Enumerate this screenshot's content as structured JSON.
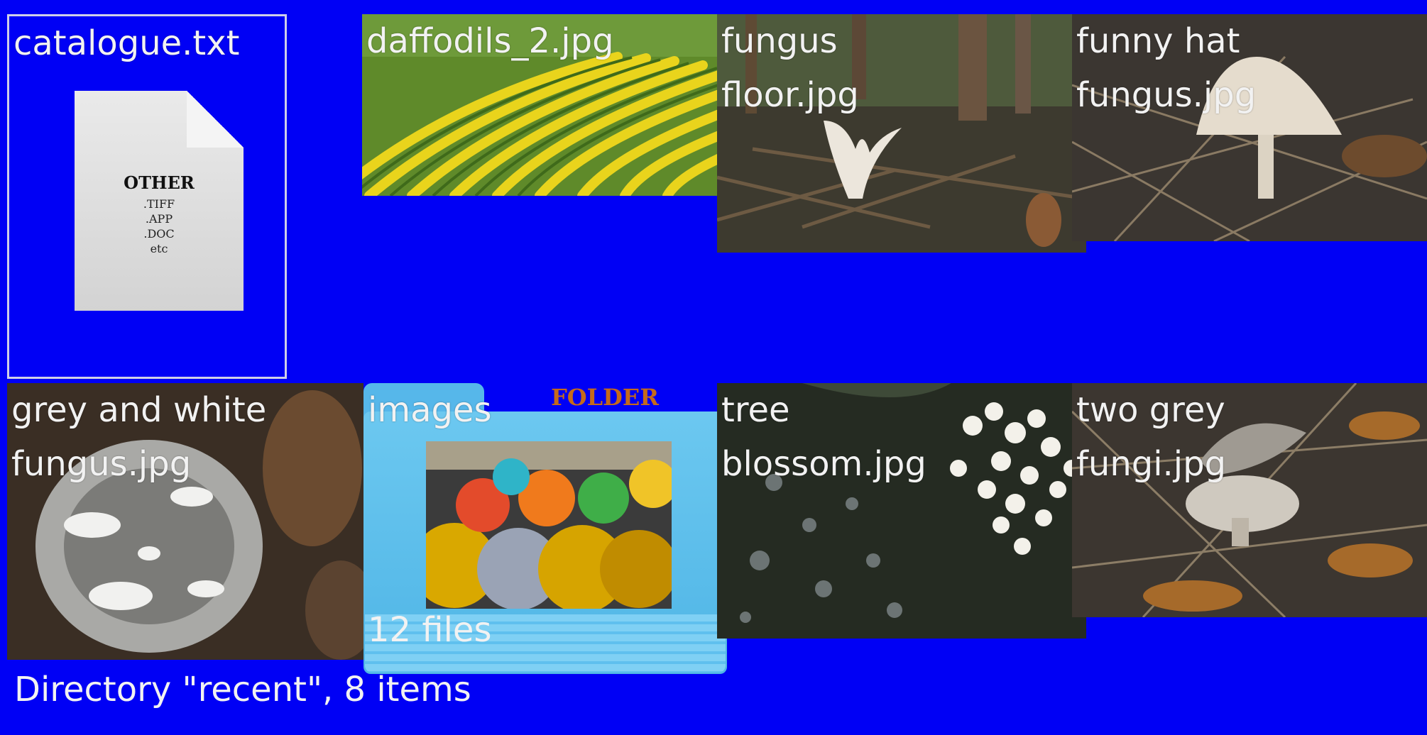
{
  "directory": {
    "status_text": "Directory \"recent\", 8 items"
  },
  "items": [
    {
      "name": "catalogue.txt",
      "type": "document",
      "icon_title": "OTHER",
      "icon_lines": [
        ".TIFF",
        ".APP",
        ".DOC",
        "etc"
      ]
    },
    {
      "name": "daffodils_2.jpg",
      "type": "image"
    },
    {
      "name": "fungus\nfloor.jpg",
      "type": "image"
    },
    {
      "name": "funny hat\nfungus.jpg",
      "type": "image"
    },
    {
      "name": "grey and white\nfungus.jpg",
      "type": "image"
    },
    {
      "name": "images",
      "type": "folder",
      "folder_tag": "FOLDER",
      "count_text": "12 files"
    },
    {
      "name": "tree\nblossom.jpg",
      "type": "image"
    },
    {
      "name": "two grey\nfungi.jpg",
      "type": "image"
    }
  ],
  "colors": {
    "background": "#0000f5",
    "label": "#f2f2f2",
    "folder": "#56b7ea",
    "folder_tag": "#c56a1a"
  }
}
